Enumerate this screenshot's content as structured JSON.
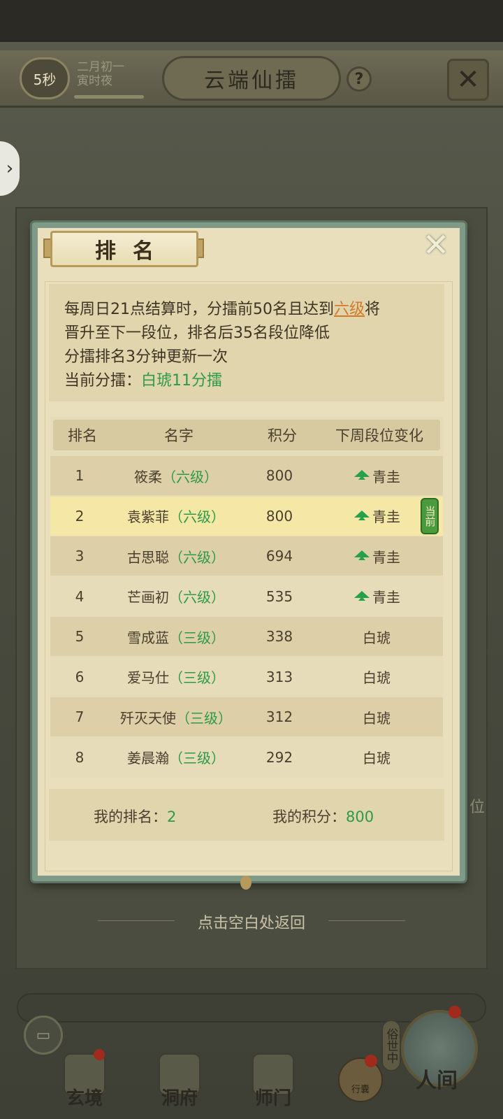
{
  "top_bar": {
    "timer": "5秒",
    "date_line1": "二月初一",
    "date_line2": "寅时夜",
    "title": "云端仙擂",
    "help": "?"
  },
  "background": {
    "side_word": "位"
  },
  "modal": {
    "title": "排名",
    "close": "✕",
    "info": {
      "line1_prefix": "每周日21点结算时，分擂前50名且达到",
      "line1_link": "六级",
      "line1_suffix": "将",
      "line2": "晋升至下一段位，排名后35名段位降低",
      "line3": "分擂排名3分钟更新一次",
      "current_label": "当前分擂：",
      "current_value": "白琥11分擂"
    },
    "table": {
      "headers": [
        "排名",
        "名字",
        "积分",
        "下周段位变化"
      ],
      "rows": [
        {
          "rank": "1",
          "name": "筱柔",
          "level": "（六级）",
          "score": "800",
          "change": "青圭",
          "up": true,
          "current": false
        },
        {
          "rank": "2",
          "name": "袁紫菲",
          "level": "（六级）",
          "score": "800",
          "change": "青圭",
          "up": true,
          "current": true
        },
        {
          "rank": "3",
          "name": "古思聪",
          "level": "（六级）",
          "score": "694",
          "change": "青圭",
          "up": true,
          "current": false
        },
        {
          "rank": "4",
          "name": "芒画初",
          "level": "（六级）",
          "score": "535",
          "change": "青圭",
          "up": true,
          "current": false
        },
        {
          "rank": "5",
          "name": "雪成蓝",
          "level": "（三级）",
          "score": "338",
          "change": "白琥",
          "up": false,
          "current": false
        },
        {
          "rank": "6",
          "name": "爱马仕",
          "level": "（三级）",
          "score": "313",
          "change": "白琥",
          "up": false,
          "current": false
        },
        {
          "rank": "7",
          "name": "歼灭天使",
          "level": "（三级）",
          "score": "312",
          "change": "白琥",
          "up": false,
          "current": false
        },
        {
          "rank": "8",
          "name": "姜晨瀚",
          "level": "（三级）",
          "score": "292",
          "change": "白琥",
          "up": false,
          "current": false
        }
      ],
      "current_badge": "当前"
    },
    "my": {
      "rank_label": "我的排名：",
      "rank_value": "2",
      "score_label": "我的积分：",
      "score_value": "800"
    }
  },
  "return_hint": "点击空白处返回",
  "bottom_nav": {
    "items": [
      "玄境",
      "洞府",
      "师门"
    ],
    "bag": "行囊",
    "world_vertical": "俗世中",
    "world": "人间"
  },
  "colors": {
    "accent_green": "#2e9a45",
    "highlight_orange": "#d27a2a",
    "modal_border": "#7f9a86",
    "current_row": "#f5e7a6"
  }
}
